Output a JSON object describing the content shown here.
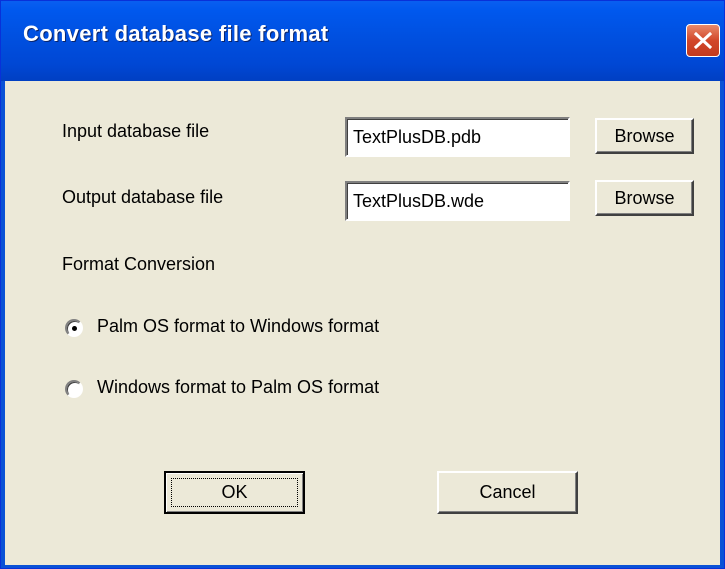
{
  "dialog": {
    "title": "Convert database file format",
    "close_icon": "close-icon"
  },
  "input_file": {
    "label": "Input database file",
    "value": "TextPlusDB.pdb",
    "browse_label": "Browse"
  },
  "output_file": {
    "label": "Output database file",
    "value": "TextPlusDB.wde",
    "browse_label": "Browse"
  },
  "conversion": {
    "label": "Format Conversion",
    "options": [
      {
        "label": "Palm OS format to Windows format",
        "selected": true
      },
      {
        "label": "Windows format to Palm OS format",
        "selected": false
      }
    ]
  },
  "buttons": {
    "ok_label": "OK",
    "cancel_label": "Cancel"
  },
  "colors": {
    "titlebar": "#0050e0",
    "client_bg": "#ece9d8",
    "close_button": "#d2472a"
  }
}
